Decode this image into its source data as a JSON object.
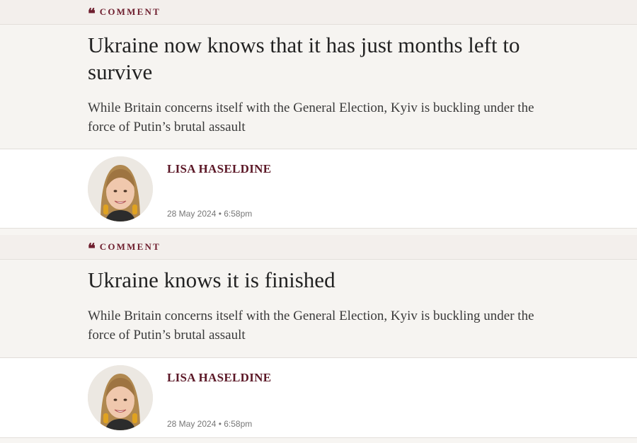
{
  "articles": [
    {
      "tag": "COMMENT",
      "headline": "Ukraine now knows that it has just months left to survive",
      "standfirst": "While Britain concerns itself with the General Election, Kyiv is buckling under the force of Putin’s brutal assault",
      "author": "LISA HASELDINE",
      "timestamp": "28 May 2024 • 6:58pm"
    },
    {
      "tag": "COMMENT",
      "headline": "Ukraine knows it is finished",
      "standfirst": "While Britain concerns itself with the General Election, Kyiv is buckling under the force of Putin’s brutal assault",
      "author": "LISA HASELDINE",
      "timestamp": "28 May 2024 • 6:58pm"
    }
  ],
  "icons": {
    "tag_icon": "quote-mark-icon",
    "avatar": "author-photo"
  },
  "colors": {
    "accent": "#6e1e2e",
    "author": "#5b1726"
  }
}
